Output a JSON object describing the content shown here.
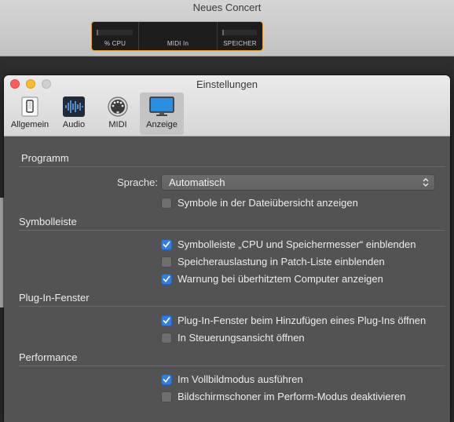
{
  "background_app": {
    "title": "Neues Concert",
    "meter": {
      "cpu_label": "% CPU",
      "midi_label": "MIDI In",
      "memory_label": "SPEICHER"
    }
  },
  "window": {
    "title": "Einstellungen",
    "tabs": [
      {
        "label": "Allgemein",
        "icon": "phone-icon",
        "active": false
      },
      {
        "label": "Audio",
        "icon": "waveform-icon",
        "active": false
      },
      {
        "label": "MIDI",
        "icon": "midi-connector-icon",
        "active": false
      },
      {
        "label": "Anzeige",
        "icon": "display-icon",
        "active": true
      }
    ]
  },
  "sections": {
    "programm": {
      "title": "Programm",
      "language_label": "Sprache:",
      "language_value": "Automatisch",
      "show_symbols": {
        "label": "Symbole in der Dateiübersicht anzeigen",
        "checked": false
      }
    },
    "symbolleiste": {
      "title": "Symbolleiste",
      "options": [
        {
          "label": "Symbolleiste „CPU und Speichermesser“ einblenden",
          "checked": true
        },
        {
          "label": "Speicherauslastung in Patch-Liste einblenden",
          "checked": false
        },
        {
          "label": "Warnung bei überhitztem Computer anzeigen",
          "checked": true
        }
      ]
    },
    "plugin": {
      "title": "Plug-In-Fenster",
      "options": [
        {
          "label": "Plug-In-Fenster beim Hinzufügen eines Plug-Ins öffnen",
          "checked": true
        },
        {
          "label": "In Steuerungsansicht öffnen",
          "checked": false
        }
      ]
    },
    "performance": {
      "title": "Performance",
      "options": [
        {
          "label": "Im Vollbildmodus ausführen",
          "checked": true
        },
        {
          "label": "Bildschirmschoner im Perform-Modus deaktivieren",
          "checked": false
        }
      ]
    }
  },
  "colors": {
    "accent": "#2f7ee0",
    "window_bg": "#535353",
    "meter_border": "#e0a23a"
  }
}
